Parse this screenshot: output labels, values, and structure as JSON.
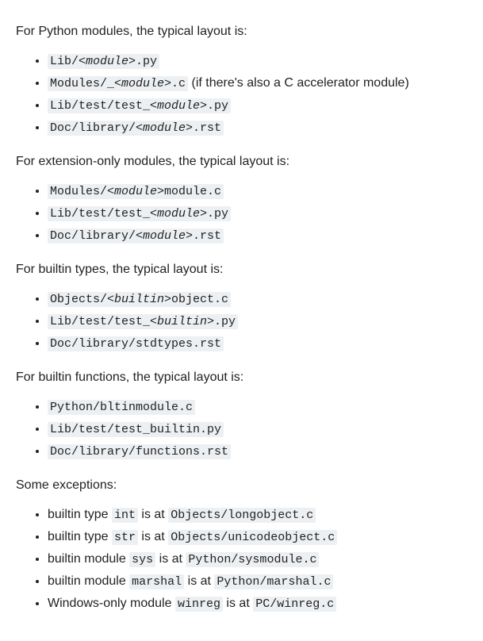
{
  "sections": [
    {
      "intro": "For Python modules, the typical layout is:",
      "items": [
        {
          "pre": "Lib/",
          "em": "<module>",
          "post": ".py",
          "trailing": ""
        },
        {
          "pre": "Modules/_",
          "em": "<module>",
          "post": ".c",
          "trailing": " (if there's also a C accelerator module)"
        },
        {
          "pre": "Lib/test/test_",
          "em": "<module>",
          "post": ".py",
          "trailing": ""
        },
        {
          "pre": "Doc/library/",
          "em": "<module>",
          "post": ".rst",
          "trailing": ""
        }
      ]
    },
    {
      "intro": "For extension-only modules, the typical layout is:",
      "items": [
        {
          "pre": "Modules/",
          "em": "<module>",
          "post": "module.c",
          "trailing": ""
        },
        {
          "pre": "Lib/test/test_",
          "em": "<module>",
          "post": ".py",
          "trailing": ""
        },
        {
          "pre": "Doc/library/",
          "em": "<module>",
          "post": ".rst",
          "trailing": ""
        }
      ]
    },
    {
      "intro": "For builtin types, the typical layout is:",
      "items": [
        {
          "pre": "Objects/",
          "em": "<builtin>",
          "post": "object.c",
          "trailing": ""
        },
        {
          "pre": "Lib/test/test_",
          "em": "<builtin>",
          "post": ".py",
          "trailing": ""
        },
        {
          "pre": "Doc/library/stdtypes.rst",
          "em": "",
          "post": "",
          "trailing": ""
        }
      ]
    },
    {
      "intro": "For builtin functions, the typical layout is:",
      "items": [
        {
          "pre": "Python/bltinmodule.c",
          "em": "",
          "post": "",
          "trailing": ""
        },
        {
          "pre": "Lib/test/test_builtin.py",
          "em": "",
          "post": "",
          "trailing": ""
        },
        {
          "pre": "Doc/library/functions.rst",
          "em": "",
          "post": "",
          "trailing": ""
        }
      ]
    }
  ],
  "exceptions_intro": "Some exceptions:",
  "exceptions": [
    {
      "text_before": "builtin type ",
      "code1": "int",
      "text_mid": " is at ",
      "code2": "Objects/longobject.c"
    },
    {
      "text_before": "builtin type ",
      "code1": "str",
      "text_mid": " is at ",
      "code2": "Objects/unicodeobject.c"
    },
    {
      "text_before": "builtin module ",
      "code1": "sys",
      "text_mid": " is at ",
      "code2": "Python/sysmodule.c"
    },
    {
      "text_before": "builtin module ",
      "code1": "marshal",
      "text_mid": " is at ",
      "code2": "Python/marshal.c"
    },
    {
      "text_before": "Windows-only module ",
      "code1": "winreg",
      "text_mid": " is at ",
      "code2": "PC/winreg.c"
    }
  ]
}
